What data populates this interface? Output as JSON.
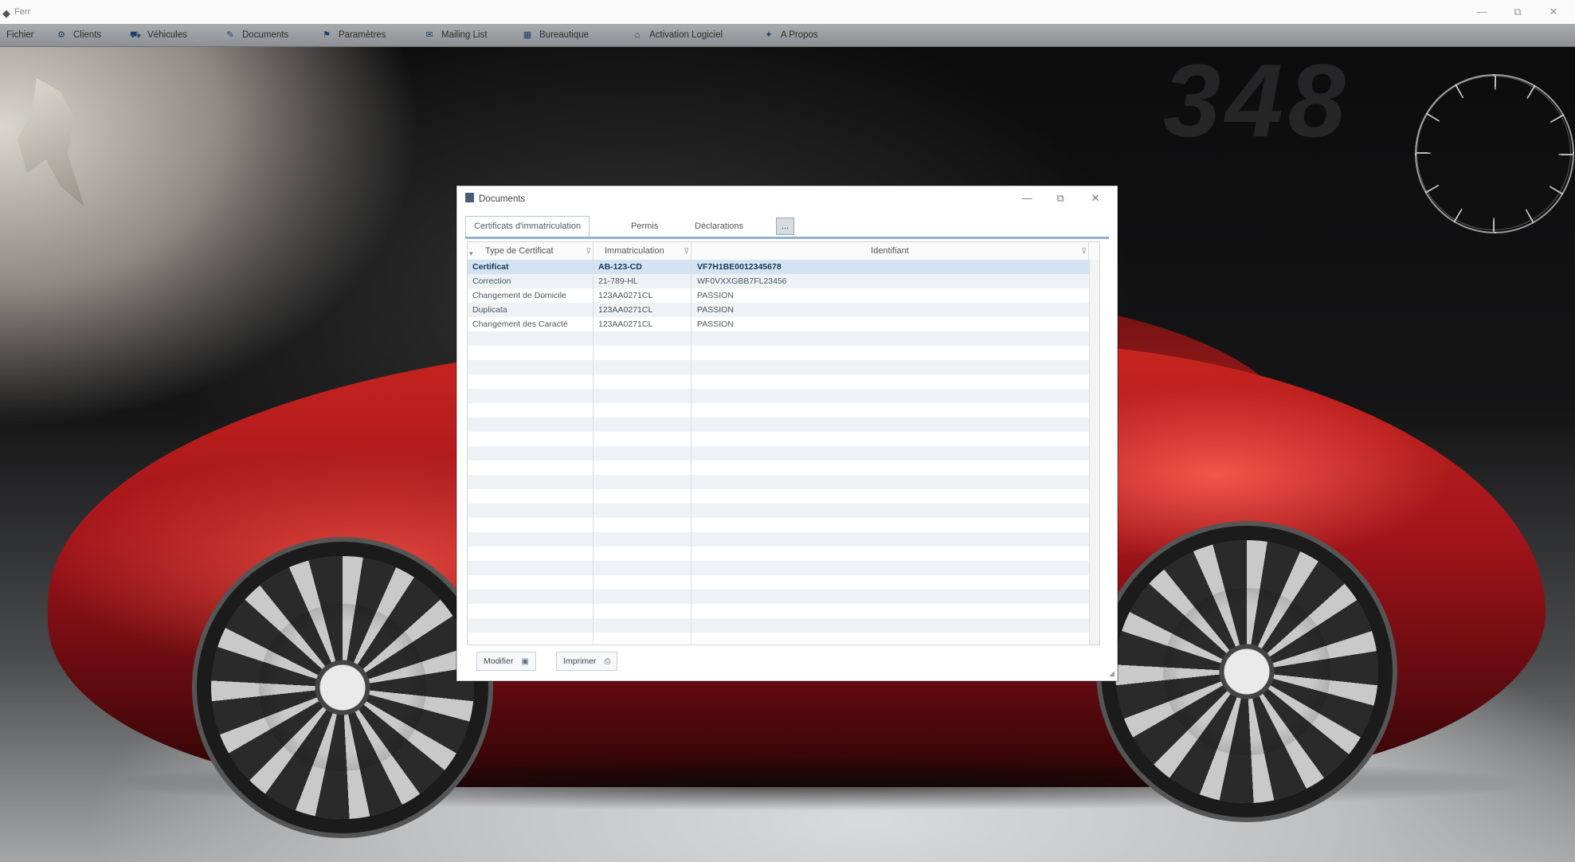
{
  "window": {
    "title": "Ferr",
    "controls": [
      "—",
      "⧉",
      "✕"
    ]
  },
  "menu": [
    {
      "label": "Fichier",
      "icon": ""
    },
    {
      "label": "Clients",
      "icon": "⚙"
    },
    {
      "label": "Véhicules",
      "icon": "⛟"
    },
    {
      "label": "Documents",
      "icon": "✎"
    },
    {
      "label": "Paramètres",
      "icon": "⚑"
    },
    {
      "label": "Mailing List",
      "icon": "✉"
    },
    {
      "label": "Bureautique",
      "icon": "▦"
    },
    {
      "label": "Activation Logiciel",
      "icon": "⌂"
    },
    {
      "label": "A Propos",
      "icon": "✦"
    }
  ],
  "dialog": {
    "title": "Documents",
    "tabs": [
      "Certificats d'immatriculation",
      "Permis",
      "Déclarations",
      "..."
    ],
    "columns": [
      "Type de Certificat",
      "Immatriculation",
      "Identifiant"
    ],
    "rows": [
      {
        "type": "Certificat",
        "immat": "AB-123-CD",
        "ident": "VF7H1BE0012345678"
      },
      {
        "type": "Correction",
        "immat": "21-789-HL",
        "ident": "WF0VXXGBB7FL23456"
      },
      {
        "type": "Changement de Domicile",
        "immat": "123AA0271CL",
        "ident": "PASSION"
      },
      {
        "type": "Duplicata",
        "immat": "123AA0271CL",
        "ident": "PASSION"
      },
      {
        "type": "Changement des Caracté",
        "immat": "123AA0271CL",
        "ident": "PASSION"
      }
    ],
    "empty_rows": 23,
    "footer": {
      "modify_label": "Modifier",
      "modify_icon": "▣",
      "print_label": "Imprimer",
      "print_icon": "⎙"
    }
  },
  "background": {
    "logo_text": "348",
    "horse_emblem": "prancing-horse-emblem",
    "car_color": "#c8251f"
  }
}
